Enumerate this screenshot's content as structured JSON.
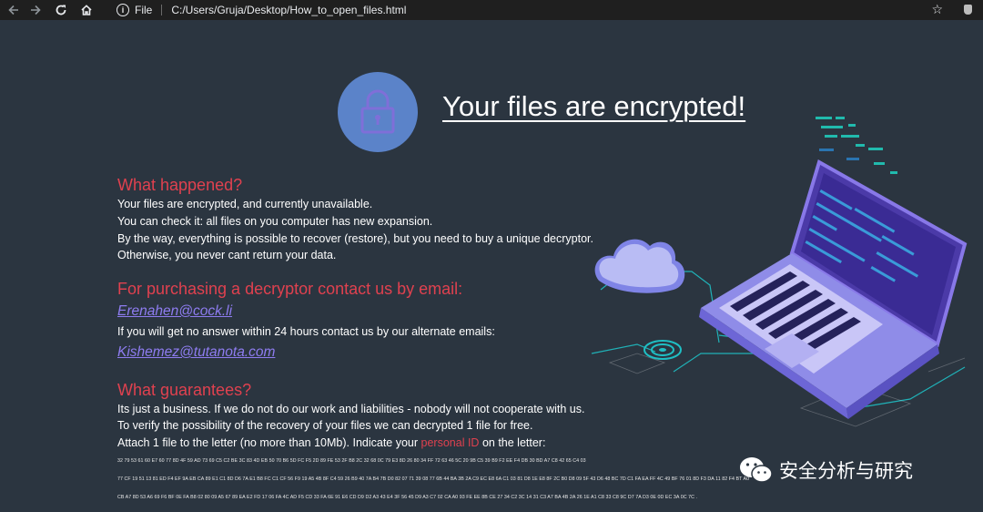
{
  "browser": {
    "back_icon": "arrow-left-icon",
    "forward_icon": "arrow-right-icon",
    "reload_icon": "reload-icon",
    "home_icon": "home-icon",
    "scheme_label": "File",
    "url": "C:/Users/Gruja/Desktop/How_to_open_files.html"
  },
  "note": {
    "headline": "Your files are encrypted!",
    "sections": [
      {
        "heading": "What happened?",
        "lines": [
          "Your files are encrypted, and currently unavailable.",
          "You can check it: all files on you computer has new expansion.",
          "By the way, everything is possible to recover (restore), but you need to buy a unique decryptor.",
          "Otherwise, you never cant return your data."
        ]
      },
      {
        "heading": "For purchasing a decryptor contact us by email:",
        "email_primary": "Erenahen@cock.li",
        "alt_line": "If you will get no answer within 24 hours contact us by our alternate emails:",
        "email_alternate": "Kishemez@tutanota.com"
      },
      {
        "heading": "What guarantees?",
        "lines": [
          "Its just a business. If we do not do our work and liabilities - nobody will not cooperate with us.",
          "To verify the possibility of the recovery of your files we can decrypted 1 file for free."
        ],
        "attach_before": "Attach 1 file to the letter (no more than 10Mb). Indicate your",
        "attach_id": "personal ID",
        "attach_after": "on the letter:"
      }
    ],
    "personal_id_lines": [
      "32 79 53 61 60 E7 60 77 8D 4F 59 AD 73 69 C5 C2 BE 3C 83 4D EB 50 70 B6 5D FC F5 2D 89 FE 53 2F B8 2C 32 68 0C 79 E3 8D 26 80 34 FF 72 63 46 5C 20 9B C5 39 B9 F2 EE F4 DB 30 BD A7 C8 42 65 C4 03",
      "77 CF 19 51 13 81 ED F4 EF 9A EB CA 89 E1 C1 8D D6 7A E1 B8 FC C1 CF 56 F9 19 A5 4B 8F C4 59 26 B9 40 7A B4 7B D0 82 07 71 39 08 77 6B 44 BA 3B 2A C9 EC E8 6A C1 03 81 D8 1E E8 8F 2C B0 D8 09 5F 43 D6 48 BC 7D C1 FA EA FF 4C 49 BF 76 01 8D F3 DA 11 82 F4 BT A0",
      "CB A7 8D 53 A6 69 F6 BF 0E FA B8 02 80 09 A5 67 89 EA E2 FD 17 06 FA 4C AD F5 CD 33 FA 6E 91 E6 CD D9 D2 A3 43 E4 3F 56 45 D9 A3 C7 02 CA A0 93 FE EE 8B CE 27 34 C2 3C 14 31 C3 A7 BA 4B 2A 26 1E A1 C8 33 C8 9C D7 7A D3 0E 0D EC 3A 0C 7C ."
    ]
  },
  "watermark": {
    "text": "安全分析与研究",
    "icon": "wechat-icon"
  },
  "colors": {
    "background": "#2b3540",
    "heading_red": "#e0414f",
    "email_purple": "#8e7cf0",
    "lock_circle": "#5b83c9"
  }
}
